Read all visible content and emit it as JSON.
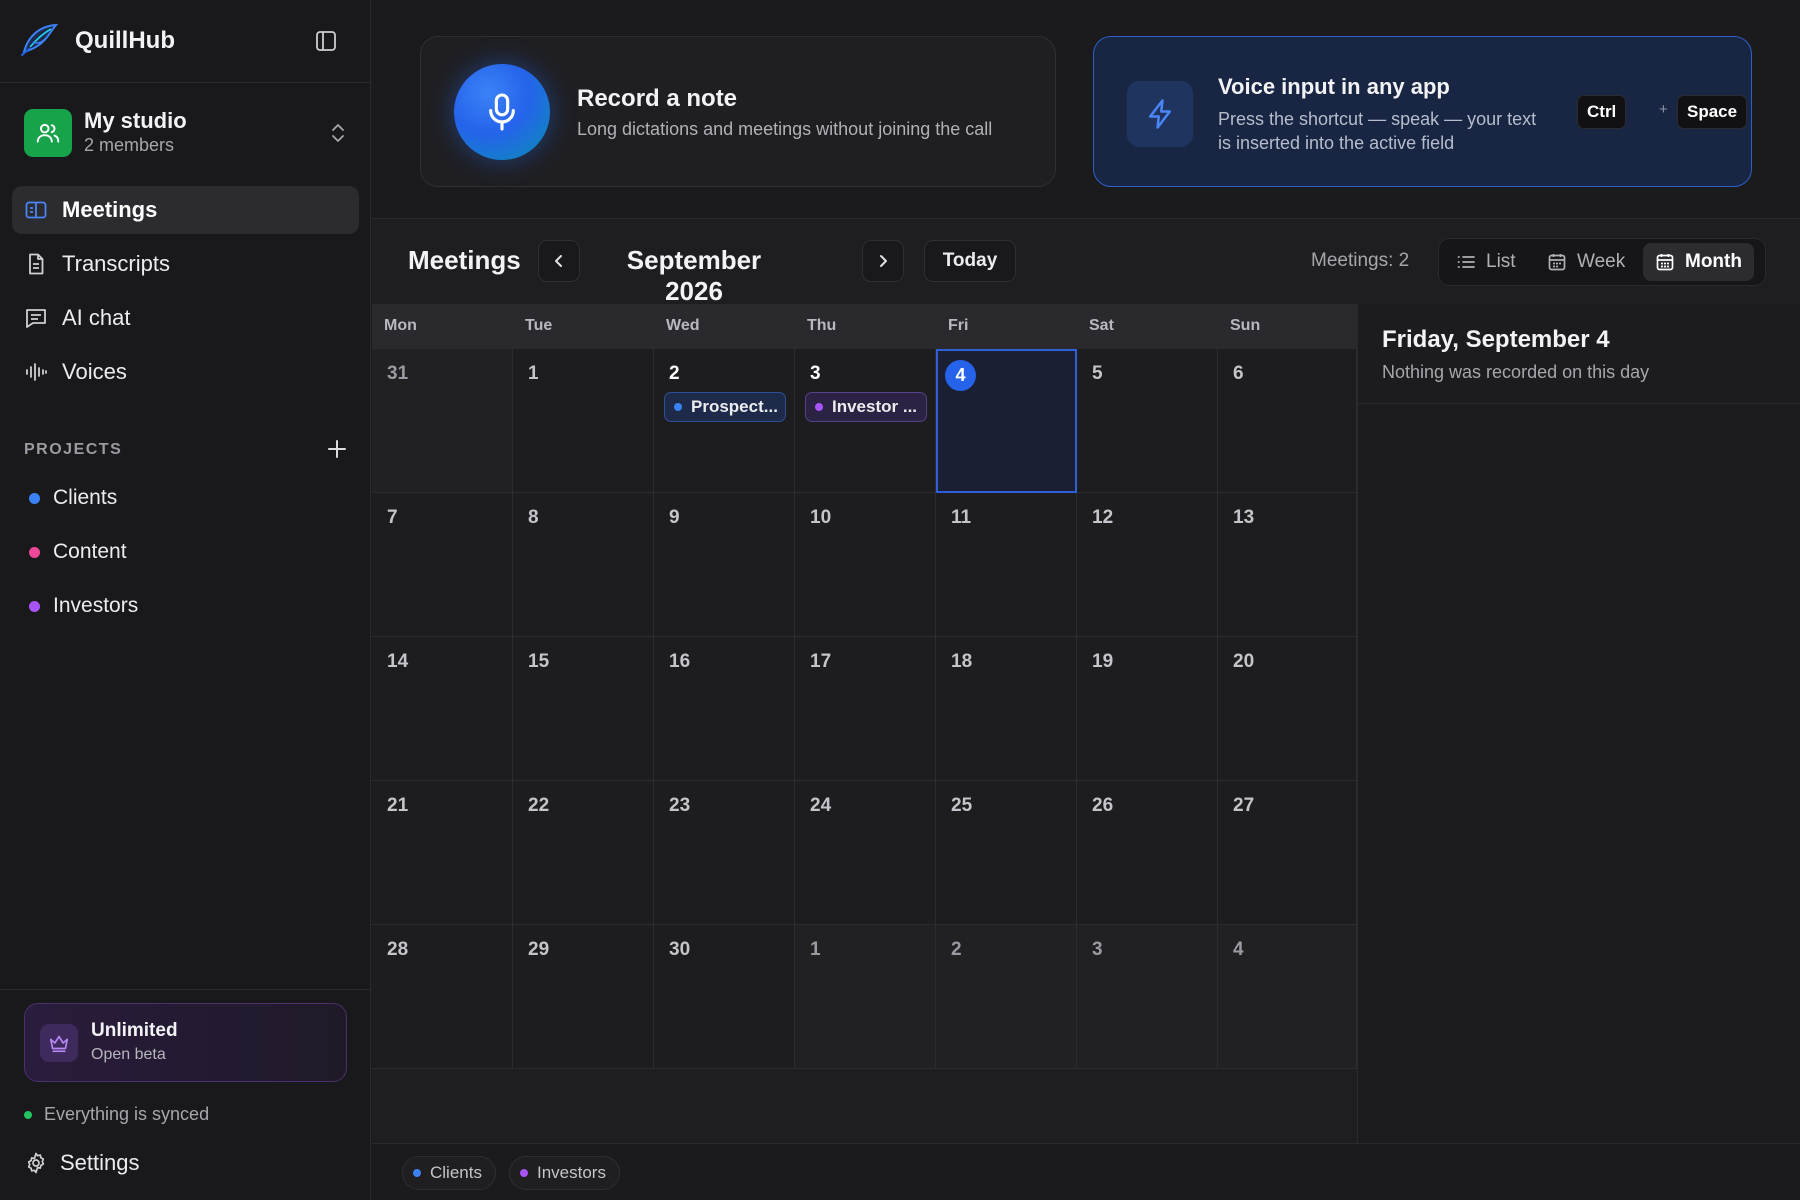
{
  "app": {
    "name": "QuillHub"
  },
  "workspace": {
    "name": "My studio",
    "members": "2 members"
  },
  "nav": [
    {
      "label": "Meetings",
      "icon": "meetings-icon",
      "active": true
    },
    {
      "label": "Transcripts",
      "icon": "document-icon",
      "active": false
    },
    {
      "label": "AI chat",
      "icon": "chat-icon",
      "active": false
    },
    {
      "label": "Voices",
      "icon": "waveform-icon",
      "active": false
    }
  ],
  "projects": {
    "heading": "PROJECTS",
    "items": [
      {
        "label": "Clients",
        "color": "#3b82f6"
      },
      {
        "label": "Content",
        "color": "#ec4899"
      },
      {
        "label": "Investors",
        "color": "#a855f7"
      }
    ]
  },
  "plan": {
    "title": "Unlimited",
    "subtitle": "Open beta"
  },
  "sync": {
    "text": "Everything is synced",
    "color": "#22c55e"
  },
  "settings": {
    "label": "Settings"
  },
  "record_card": {
    "title": "Record a note",
    "subtitle": "Long dictations and meetings without joining the call"
  },
  "voice_card": {
    "title": "Voice input in any app",
    "subtitle": "Press the shortcut — speak — your text is inserted into the active field",
    "keys": [
      "Ctrl",
      "Space"
    ],
    "plus": "+"
  },
  "toolbar": {
    "title": "Meetings",
    "month": "September 2026",
    "today": "Today",
    "count": "Meetings: 2",
    "views": [
      {
        "label": "List",
        "active": false
      },
      {
        "label": "Week",
        "active": false
      },
      {
        "label": "Month",
        "active": true
      }
    ]
  },
  "calendar": {
    "weekdays": [
      "Mon",
      "Tue",
      "Wed",
      "Thu",
      "Fri",
      "Sat",
      "Sun"
    ],
    "weeks": [
      [
        {
          "day": "31",
          "out": true
        },
        {
          "day": "1"
        },
        {
          "day": "2",
          "event": {
            "label": "Prospect...",
            "project": "Clients",
            "color": "#3b82f6",
            "style": "blue"
          }
        },
        {
          "day": "3",
          "event": {
            "label": "Investor ...",
            "project": "Investors",
            "color": "#a855f7",
            "style": "purple"
          }
        },
        {
          "day": "4",
          "today": true
        },
        {
          "day": "5"
        },
        {
          "day": "6"
        }
      ],
      [
        {
          "day": "7"
        },
        {
          "day": "8"
        },
        {
          "day": "9"
        },
        {
          "day": "10"
        },
        {
          "day": "11"
        },
        {
          "day": "12"
        },
        {
          "day": "13"
        }
      ],
      [
        {
          "day": "14"
        },
        {
          "day": "15"
        },
        {
          "day": "16"
        },
        {
          "day": "17"
        },
        {
          "day": "18"
        },
        {
          "day": "19"
        },
        {
          "day": "20"
        }
      ],
      [
        {
          "day": "21"
        },
        {
          "day": "22"
        },
        {
          "day": "23"
        },
        {
          "day": "24"
        },
        {
          "day": "25"
        },
        {
          "day": "26"
        },
        {
          "day": "27"
        }
      ],
      [
        {
          "day": "28"
        },
        {
          "day": "29"
        },
        {
          "day": "30"
        },
        {
          "day": "1",
          "out": true
        },
        {
          "day": "2",
          "out": true
        },
        {
          "day": "3",
          "out": true
        },
        {
          "day": "4",
          "out": true
        }
      ]
    ]
  },
  "day_panel": {
    "title": "Friday, September 4",
    "subtitle": "Nothing was recorded on this day"
  },
  "legend": [
    {
      "label": "Clients",
      "color": "#3b82f6"
    },
    {
      "label": "Investors",
      "color": "#a855f7"
    }
  ]
}
